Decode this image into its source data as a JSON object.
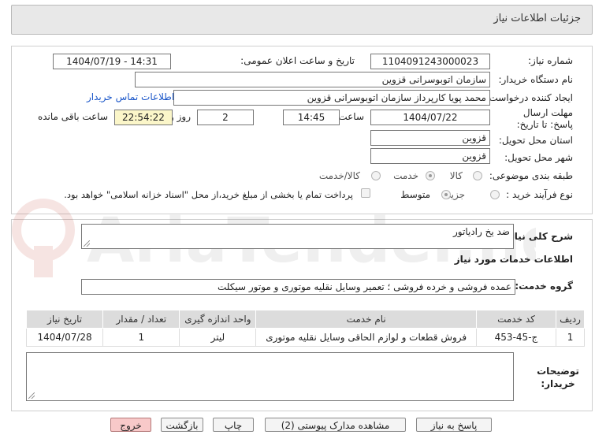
{
  "header": {
    "title": "جزئیات اطلاعات نیاز"
  },
  "form": {
    "need_number_label": "شماره نیاز:",
    "need_number": "1104091243000023",
    "announce_label": "تاریخ و ساعت اعلان عمومی:",
    "announce_value": "1404/07/19 - 14:31",
    "buyer_org_label": "نام دستگاه خریدار:",
    "buyer_org": "سازمان اتوبوسرانی قزوین",
    "creator_label": "ایجاد کننده درخواست:",
    "creator": "محمد پویا کارپرداز سازمان اتوبوسرانی قزوین",
    "contact_link": "اطلاعات تماس خریدار",
    "deadline_label": "مهلت ارسال پاسخ: تا تاریخ:",
    "deadline_date": "1404/07/22",
    "time_label": "ساعت",
    "deadline_time": "14:45",
    "days": "2",
    "days_label": "روز و",
    "remaining": "22:54:22",
    "remaining_label": "ساعت باقی مانده",
    "province_label": "استان محل تحویل:",
    "province": "قزوین",
    "city_label": "شهر محل تحویل:",
    "city": "قزوین",
    "category_label": "طبقه بندی موضوعی:",
    "category_options": [
      "کالا",
      "خدمت",
      "کالا/خدمت"
    ],
    "category_selected": "خدمت",
    "process_label": "نوع فرآیند خرید :",
    "process_options": [
      "جزیی",
      "متوسط"
    ],
    "process_selected": "متوسط",
    "payment_note": "پرداخت تمام یا بخشی از مبلغ خرید،از محل \"اسناد خزانه اسلامی\" خواهد بود."
  },
  "details": {
    "description_label": "شرح کلی نیاز:",
    "description": "ضد یخ رادیاتور",
    "services_title": "اطلاعات خدمات مورد نیاز",
    "service_group_label": "گروه خدمت:",
    "service_group": "عمده فروشی و خرده فروشی ؛ تعمیر وسایل نقلیه موتوری و موتور سیکلت",
    "table": {
      "headers": [
        "ردیف",
        "کد خدمت",
        "نام خدمت",
        "واحد اندازه گیری",
        "تعداد / مقدار",
        "تاریخ نیاز"
      ],
      "rows": [
        [
          "1",
          "ج-45-453",
          "فروش قطعات و لوازم الحاقی وسایل نقلیه موتوری",
          "لیتر",
          "1",
          "1404/07/28"
        ]
      ]
    },
    "buyer_notes_label": "توضیحات خریدار:",
    "buyer_notes": ""
  },
  "buttons": {
    "respond": "پاسخ به نیاز",
    "view_docs": "مشاهده مدارک پیوستی (2)",
    "print": "چاپ",
    "back": "بازگشت",
    "exit": "خروج"
  },
  "watermark": {
    "text": "AriaTender.neT"
  },
  "colors": {
    "link": "#1a56c9",
    "highlight": "#fbf6c9",
    "exit_button": "#f8c9c9",
    "header_bg": "#e8e8e8"
  }
}
